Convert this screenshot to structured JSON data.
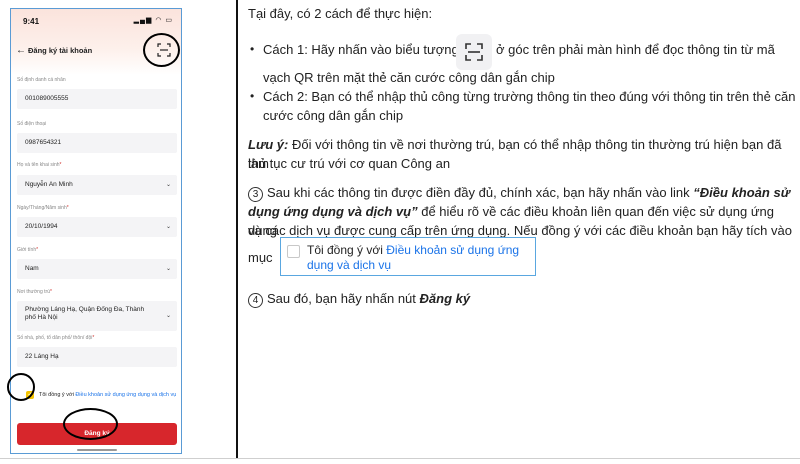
{
  "phone": {
    "status_time": "9:41",
    "nav_title": "Đăng ký tài khoản",
    "fields": [
      {
        "label": "Số định danh cá nhân",
        "value": "001089005555"
      },
      {
        "label": "Số điện thoại",
        "value": "0987654321"
      },
      {
        "label": "Họ và tên khai sinh",
        "value": "Nguyễn An Minh"
      },
      {
        "label": "Ngày/Tháng/Năm sinh",
        "value": "20/10/1994"
      },
      {
        "label": "Giới tính",
        "value": "Nam"
      },
      {
        "label": "Nơi thường trú",
        "value": "Phường Láng Hạ, Quận Đống Đa, Thành phố Hà Nội"
      },
      {
        "label": "Số nhà, phố, tổ dân phố/ thôn/ đội",
        "value": "22 Láng Hạ"
      }
    ],
    "agree_prefix": "Tôi đồng ý với ",
    "agree_link": "Điều khoản sử dụng ứng dụng và dịch vụ",
    "register_label": "Đăng ký"
  },
  "instructions": {
    "intro": "Tại đây, có 2 cách để thực hiện:",
    "method1_a": "Cách 1: Hãy nhấn vào biểu tượng",
    "method1_b": "ở góc trên phải màn hình để đọc thông tin từ mã",
    "method1_c": "vạch QR trên mặt thẻ căn cước công dân gắn chip",
    "method2_a": "Cách 2: Bạn có thể nhập thủ công từng trường thông tin theo đúng với thông tin trên thẻ căn",
    "method2_b": "cước công dân gắn chip",
    "note_label": "Lưu ý:",
    "note_a": " Đối với thông tin về nơi thường trú, bạn có thể nhập thông tin thường trú hiện bạn đã làm",
    "note_b": "thủ tục cư trú với cơ quan Công an",
    "step3_num": "3",
    "step3_a": "Sau khi các thông tin được điền đầy đủ, chính xác, bạn hãy nhấn vào link ",
    "step3_link_a": "“Điều khoản sử",
    "step3_link_b": "dụng ứng dụng và dịch vụ”",
    "step3_b": " để hiểu rõ về các điều khoản liên quan đến việc sử dụng ứng dụng",
    "step3_c": "và các dịch vụ được cung cấp trên ứng dụng. Nếu đồng ý với các điều khoản bạn hãy tích vào",
    "step3_d": "mục",
    "consent_prefix": "Tôi đồng ý với ",
    "consent_link": "Điều khoản sử dụng ứng dụng và dịch vụ",
    "step4_num": "4",
    "step4_a": "Sau đó, bạn hãy nhấn nút ",
    "step4_b": "Đăng ký"
  },
  "colors": {
    "accent_red": "#d7262c",
    "link_blue": "#1a73e8",
    "check_yellow": "#f5c400"
  }
}
